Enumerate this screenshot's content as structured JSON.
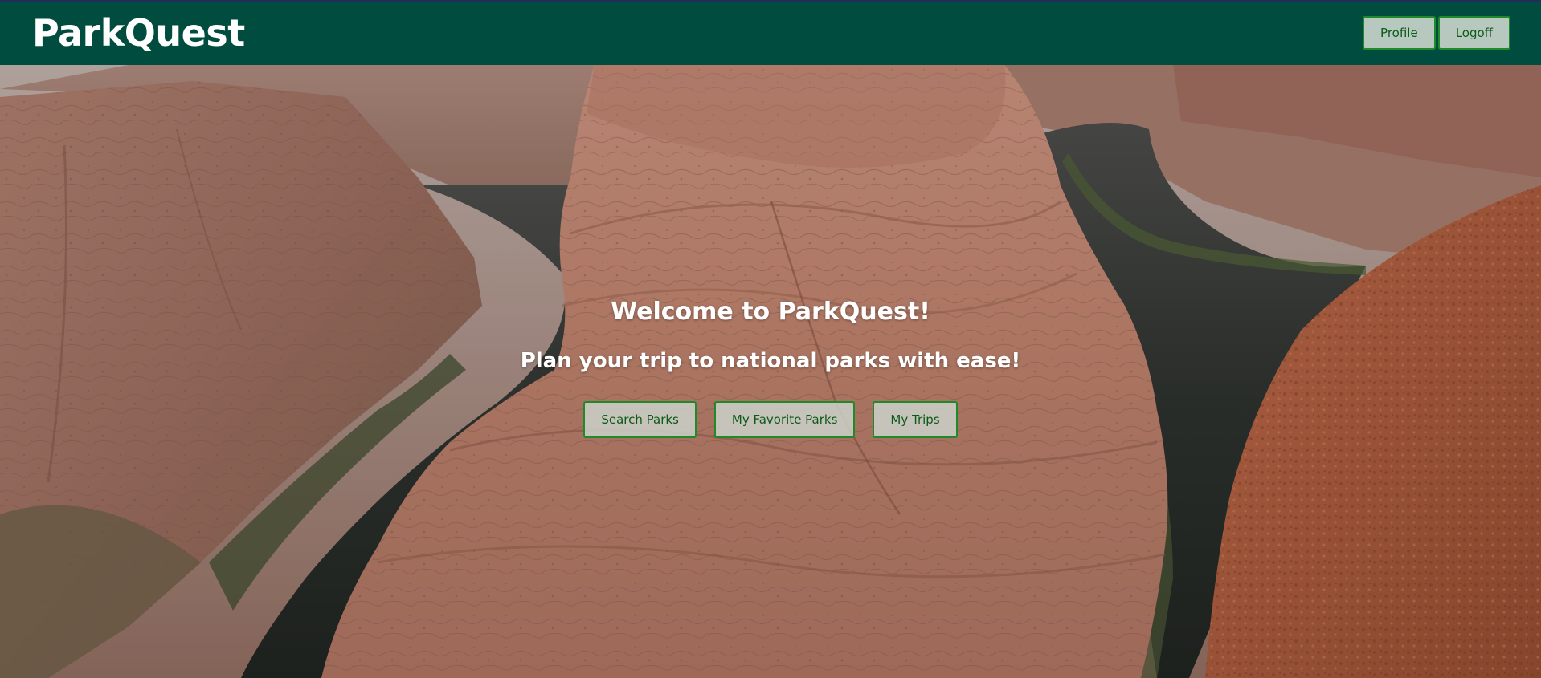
{
  "app": {
    "brand": "ParkQuest"
  },
  "nav": {
    "profile_label": "Profile",
    "logoff_label": "Logoff"
  },
  "hero": {
    "welcome": "Welcome to ParkQuest!",
    "tagline": "Plan your trip to national parks with ease!",
    "buttons": [
      {
        "label": "Search Parks"
      },
      {
        "label": "My Favorite Parks"
      },
      {
        "label": "My Trips"
      }
    ]
  },
  "colors": {
    "navbar": "#004d40",
    "button_border": "#1e8a2a",
    "button_text": "#0b5a18"
  }
}
